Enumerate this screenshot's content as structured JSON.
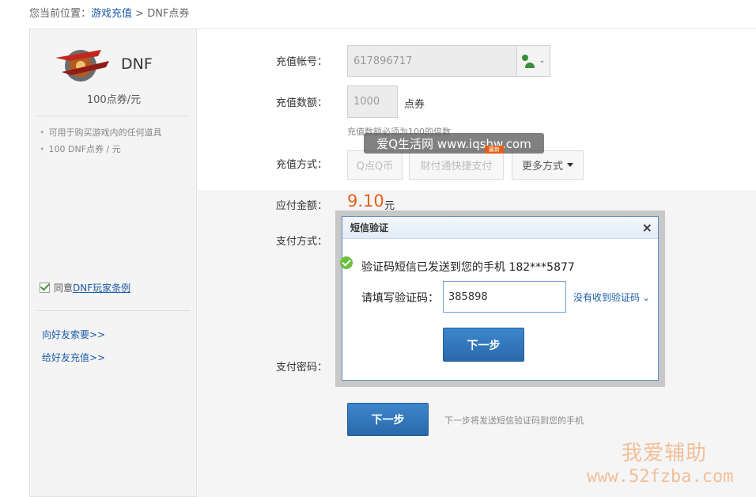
{
  "breadcrumb": {
    "prefix": "您当前位置：",
    "link": "游戏充值",
    "separator": " > ",
    "current": "DNF点券"
  },
  "sidebar": {
    "game_name": "DNF",
    "price": "100点券/元",
    "bullets": [
      "可用于购买游戏内的任何道具",
      "100 DNF点券 / 元"
    ],
    "agree_prefix": "同意 ",
    "agree_link": "DNF玩家条例",
    "links": [
      "向好友索要>>",
      "给好友充值>>"
    ]
  },
  "form": {
    "account_label": "充值帐号：",
    "account_value": "617896717",
    "quantity_label": "充值数额：",
    "quantity_value": "1000",
    "quantity_unit": "点券",
    "quantity_hint": "充值数额必须为100的倍数",
    "method_label": "充值方式：",
    "methods": [
      "Q点Q币",
      "财付通快捷支付",
      "更多方式"
    ],
    "amount_label": "应付金额：",
    "amount_value": "9.10",
    "amount_unit": "元",
    "pay_label": "支付方式：",
    "password_label": "支付密码：",
    "next_button": "下一步",
    "next_note": "下一步将发送短信验证码到您的手机"
  },
  "dialog": {
    "title": "短信验证",
    "close": "×",
    "sent_message": "验证码短信已发送到您的手机 182***5877",
    "code_label": "请填写验证码：",
    "code_value": "385898",
    "no_code_link": "没有收到验证码",
    "next_button": "下一步"
  },
  "watermark": {
    "strip_text": "爱Q生活网 www.iqshw.com",
    "tag": "最新",
    "site_cn": "我爱辅助",
    "site_url": "www.52fzba.com"
  },
  "colors": {
    "link": "#1a5aa8",
    "amount": "#e3601a",
    "button": "#2f74bb"
  }
}
